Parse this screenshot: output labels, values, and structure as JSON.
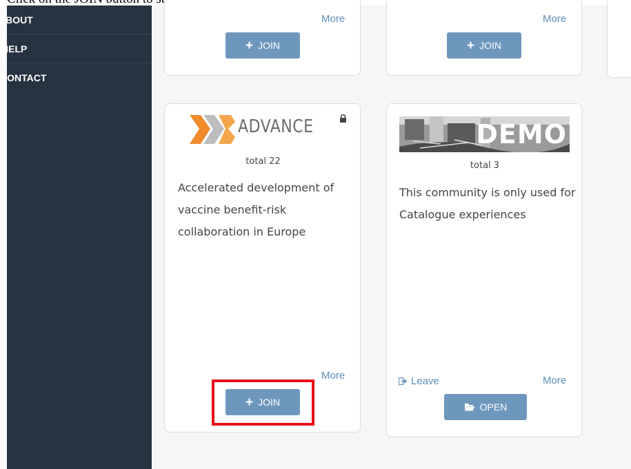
{
  "caption": "Click on the JOIN button to start the approval request.",
  "sidebar": {
    "items": [
      {
        "label": "ABOUT"
      },
      {
        "label": "HELP"
      },
      {
        "label": "CONTACT"
      }
    ]
  },
  "cards": [
    {
      "more": "More",
      "button": "JOIN"
    },
    {
      "more": "More",
      "button": "JOIN"
    },
    {
      "logo_text": "ADVANCE",
      "total": "total 22",
      "description": "Accelerated development of vaccine benefit-risk collaboration in Europe",
      "more": "More",
      "button": "JOIN",
      "locked": true
    },
    {
      "banner_text": "DEMO",
      "total": "total 3",
      "description": "This community is only used for Catalogue experiences",
      "leave": "Leave",
      "more": "More",
      "button": "OPEN"
    }
  ],
  "colors": {
    "sidebar_bg": "#263340",
    "button_bg": "#6e97bd",
    "link": "#5b8db8",
    "highlight": "#e8101a"
  },
  "icons": {
    "join": "plus-icon",
    "lock": "lock-icon",
    "leave": "sign-out-icon",
    "open": "folder-open-icon"
  }
}
